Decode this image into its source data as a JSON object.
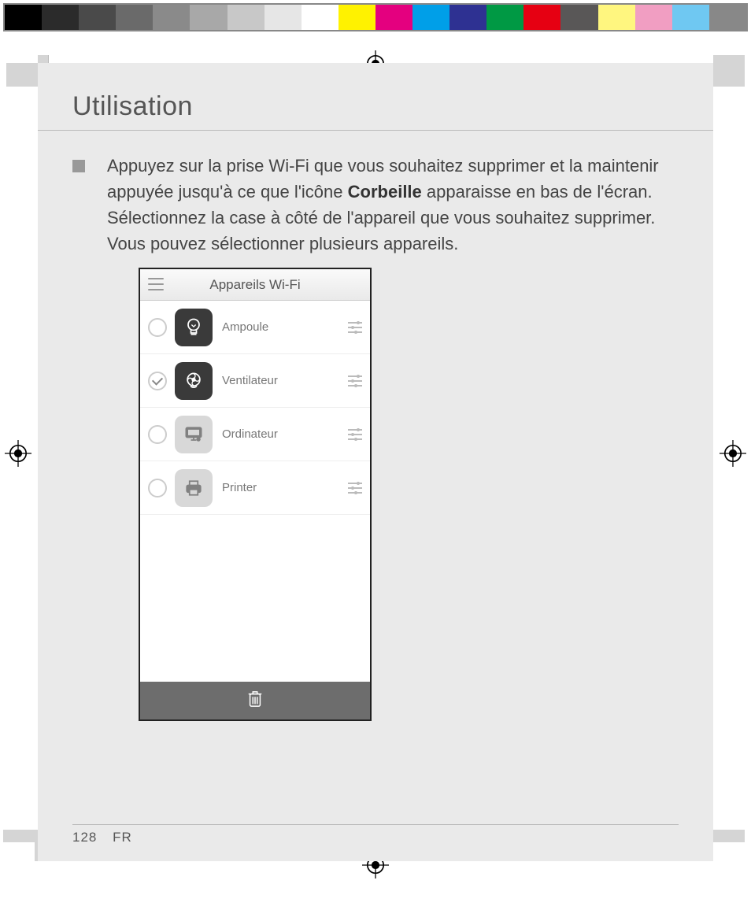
{
  "calibration_colors": [
    "#000000",
    "#2b2b2b",
    "#4a4a4a",
    "#6a6a6a",
    "#8a8a8a",
    "#a8a8a8",
    "#c8c8c8",
    "#e6e6e6",
    "#ffffff",
    "#fff200",
    "#e4007f",
    "#009fe8",
    "#2e3192",
    "#009944",
    "#e60012",
    "#595757",
    "#fff67f",
    "#f19ec2",
    "#6fc8f2",
    "#888888"
  ],
  "page": {
    "title": "Utilisation",
    "bullet_text_pre": "Appuyez sur la prise Wi-Fi que vous souhaitez supprimer et la maintenir appuyée jusqu'à ce que l'icône ",
    "bullet_bold": "Corbeille",
    "bullet_text_post": " apparaisse en bas de l'écran. Sélectionnez la case à côté de l'appareil que vous souhaitez supprimer. Vous pouvez sélectionner plusieurs appareils.",
    "footer_page": "128",
    "footer_lang": "FR"
  },
  "phone": {
    "header_title": "Appareils Wi-Fi",
    "devices": [
      {
        "label": "Ampoule",
        "checked": false,
        "icon_style": "dark",
        "icon": "bulb"
      },
      {
        "label": "Ventilateur",
        "checked": true,
        "icon_style": "dark",
        "icon": "fan"
      },
      {
        "label": "Ordinateur",
        "checked": false,
        "icon_style": "light",
        "icon": "computer"
      },
      {
        "label": "Printer",
        "checked": false,
        "icon_style": "light",
        "icon": "printer"
      }
    ]
  }
}
